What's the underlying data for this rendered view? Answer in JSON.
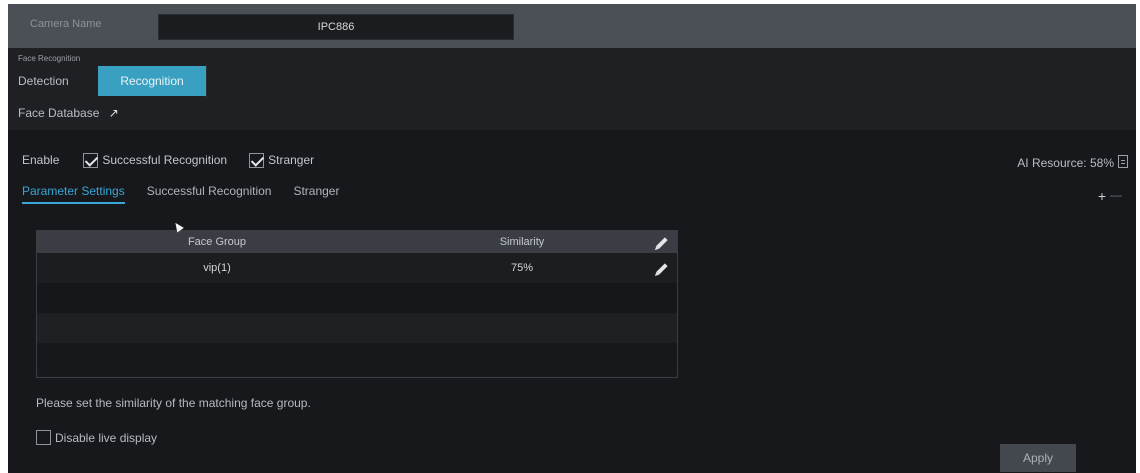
{
  "camera": {
    "label": "Camera Name",
    "value": "IPC886"
  },
  "face_recognition": {
    "title": "Face Recognition",
    "tabs": [
      {
        "label": "Detection",
        "active": false
      },
      {
        "label": "Recognition",
        "active": true
      }
    ],
    "face_database": "Face Database"
  },
  "enable_row": {
    "label": "Enable",
    "options": [
      {
        "label": "Successful Recognition",
        "checked": true
      },
      {
        "label": "Stranger",
        "checked": true
      }
    ]
  },
  "ai_resource": "AI Resource: 58%",
  "subtabs": [
    {
      "label": "Parameter Settings",
      "active": true
    },
    {
      "label": "Successful Recognition",
      "active": false
    },
    {
      "label": "Stranger",
      "active": false
    }
  ],
  "table": {
    "headers": {
      "group": "Face Group",
      "similarity": "Similarity"
    },
    "rows": [
      {
        "group": "vip(1)",
        "similarity": "75%"
      }
    ]
  },
  "hint": "Please set the similarity of the matching face group.",
  "live_display": {
    "label": "Disable live display",
    "checked": false
  },
  "apply_label": "Apply",
  "colors": {
    "accent": "#3aa0c2",
    "active_tab_text": "#3aa6d6",
    "background": "#16181b"
  },
  "icons": [
    "external-link-icon",
    "document-icon",
    "plus-icon",
    "minus-icon",
    "edit-icon",
    "cursor-icon"
  ]
}
